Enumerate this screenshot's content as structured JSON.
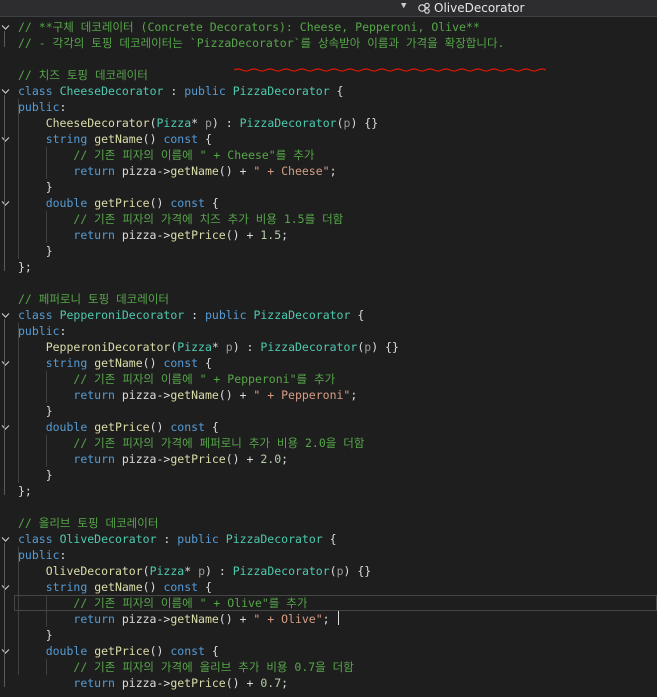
{
  "navigation": {
    "member_dropdown_label": "OliveDecorator"
  },
  "colors": {
    "background": "#1e1e1e",
    "comment": "#57a64a",
    "keyword": "#569cd6",
    "type": "#4ec9b0",
    "function": "#dcdcaa",
    "string": "#d69d85",
    "number": "#b5cea8",
    "spellcheck_squiggle": "#e51400"
  },
  "editor": {
    "lines": [
      [
        [
          "// **구체 데코레이터 (Concrete Decorators): Cheese, Pepperoni, Olive**",
          "cm"
        ]
      ],
      [
        [
          "// - 각각의 토핑 데코레이터는 `PizzaDecorator`를 상속받아 이름과 가격을 확장합니다.",
          "cm"
        ]
      ],
      [],
      [
        [
          "// 치즈 토핑 데코레이터",
          "cm"
        ]
      ],
      [
        [
          "class",
          "kw"
        ],
        [
          " ",
          "tx"
        ],
        [
          "CheeseDecorator",
          "ty"
        ],
        [
          " : ",
          "tx"
        ],
        [
          "public",
          "kw"
        ],
        [
          " ",
          "tx"
        ],
        [
          "PizzaDecorator",
          "ty"
        ],
        [
          " {",
          "tx"
        ]
      ],
      [
        [
          "public",
          "kw"
        ],
        [
          ":",
          "tx"
        ]
      ],
      [
        [
          "    ",
          "tx"
        ],
        [
          "CheeseDecorator",
          "fn"
        ],
        [
          "(",
          "tx"
        ],
        [
          "Pizza",
          "ty"
        ],
        [
          "* ",
          "tx"
        ],
        [
          "p",
          "pa"
        ],
        [
          ") : ",
          "tx"
        ],
        [
          "PizzaDecorator",
          "ty"
        ],
        [
          "(",
          "tx"
        ],
        [
          "p",
          "pa"
        ],
        [
          ") {}",
          "tx"
        ]
      ],
      [
        [
          "    ",
          "tx"
        ],
        [
          "string",
          "kw"
        ],
        [
          " ",
          "tx"
        ],
        [
          "getName",
          "fn"
        ],
        [
          "() ",
          "tx"
        ],
        [
          "const",
          "kw"
        ],
        [
          " {",
          "tx"
        ]
      ],
      [
        [
          "        ",
          "tx"
        ],
        [
          "// 기존 피자의 이름에 \" + Cheese\"를 추가",
          "cm"
        ]
      ],
      [
        [
          "        ",
          "tx"
        ],
        [
          "return",
          "kw"
        ],
        [
          " pizza->",
          "tx"
        ],
        [
          "getName",
          "fn"
        ],
        [
          "() + ",
          "tx"
        ],
        [
          "\" + Cheese\"",
          "st"
        ],
        [
          ";",
          "tx"
        ]
      ],
      [
        [
          "    }",
          "tx"
        ]
      ],
      [
        [
          "    ",
          "tx"
        ],
        [
          "double",
          "kw"
        ],
        [
          " ",
          "tx"
        ],
        [
          "getPrice",
          "fn"
        ],
        [
          "() ",
          "tx"
        ],
        [
          "const",
          "kw"
        ],
        [
          " {",
          "tx"
        ]
      ],
      [
        [
          "        ",
          "tx"
        ],
        [
          "// 기존 피자의 가격에 치즈 추가 비용 1.5를 더함",
          "cm"
        ]
      ],
      [
        [
          "        ",
          "tx"
        ],
        [
          "return",
          "kw"
        ],
        [
          " pizza->",
          "tx"
        ],
        [
          "getPrice",
          "fn"
        ],
        [
          "() + ",
          "tx"
        ],
        [
          "1.5",
          "nu"
        ],
        [
          ";",
          "tx"
        ]
      ],
      [
        [
          "    }",
          "tx"
        ]
      ],
      [
        [
          "};",
          "tx"
        ]
      ],
      [],
      [
        [
          "// 페퍼로니 토핑 데코레이터",
          "cm"
        ]
      ],
      [
        [
          "class",
          "kw"
        ],
        [
          " ",
          "tx"
        ],
        [
          "PepperoniDecorator",
          "ty"
        ],
        [
          " : ",
          "tx"
        ],
        [
          "public",
          "kw"
        ],
        [
          " ",
          "tx"
        ],
        [
          "PizzaDecorator",
          "ty"
        ],
        [
          " {",
          "tx"
        ]
      ],
      [
        [
          "public",
          "kw"
        ],
        [
          ":",
          "tx"
        ]
      ],
      [
        [
          "    ",
          "tx"
        ],
        [
          "PepperoniDecorator",
          "fn"
        ],
        [
          "(",
          "tx"
        ],
        [
          "Pizza",
          "ty"
        ],
        [
          "* ",
          "tx"
        ],
        [
          "p",
          "pa"
        ],
        [
          ") : ",
          "tx"
        ],
        [
          "PizzaDecorator",
          "ty"
        ],
        [
          "(",
          "tx"
        ],
        [
          "p",
          "pa"
        ],
        [
          ") {}",
          "tx"
        ]
      ],
      [
        [
          "    ",
          "tx"
        ],
        [
          "string",
          "kw"
        ],
        [
          " ",
          "tx"
        ],
        [
          "getName",
          "fn"
        ],
        [
          "() ",
          "tx"
        ],
        [
          "const",
          "kw"
        ],
        [
          " {",
          "tx"
        ]
      ],
      [
        [
          "        ",
          "tx"
        ],
        [
          "// 기존 피자의 이름에 \" + Pepperoni\"를 추가",
          "cm"
        ]
      ],
      [
        [
          "        ",
          "tx"
        ],
        [
          "return",
          "kw"
        ],
        [
          " pizza->",
          "tx"
        ],
        [
          "getName",
          "fn"
        ],
        [
          "() + ",
          "tx"
        ],
        [
          "\" + Pepperoni\"",
          "st"
        ],
        [
          ";",
          "tx"
        ]
      ],
      [
        [
          "    }",
          "tx"
        ]
      ],
      [
        [
          "    ",
          "tx"
        ],
        [
          "double",
          "kw"
        ],
        [
          " ",
          "tx"
        ],
        [
          "getPrice",
          "fn"
        ],
        [
          "() ",
          "tx"
        ],
        [
          "const",
          "kw"
        ],
        [
          " {",
          "tx"
        ]
      ],
      [
        [
          "        ",
          "tx"
        ],
        [
          "// 기존 피자의 가격에 페퍼로니 추가 비용 2.0을 더함",
          "cm"
        ]
      ],
      [
        [
          "        ",
          "tx"
        ],
        [
          "return",
          "kw"
        ],
        [
          " pizza->",
          "tx"
        ],
        [
          "getPrice",
          "fn"
        ],
        [
          "() + ",
          "tx"
        ],
        [
          "2.0",
          "nu"
        ],
        [
          ";",
          "tx"
        ]
      ],
      [
        [
          "    }",
          "tx"
        ]
      ],
      [
        [
          "};",
          "tx"
        ]
      ],
      [],
      [
        [
          "// 올리브 토핑 데코레이터",
          "cm"
        ]
      ],
      [
        [
          "class",
          "kw"
        ],
        [
          " ",
          "tx"
        ],
        [
          "OliveDecorator",
          "ty"
        ],
        [
          " : ",
          "tx"
        ],
        [
          "public",
          "kw"
        ],
        [
          " ",
          "tx"
        ],
        [
          "PizzaDecorator",
          "ty"
        ],
        [
          " {",
          "tx"
        ]
      ],
      [
        [
          "public",
          "kw"
        ],
        [
          ":",
          "tx"
        ]
      ],
      [
        [
          "    ",
          "tx"
        ],
        [
          "OliveDecorator",
          "fn"
        ],
        [
          "(",
          "tx"
        ],
        [
          "Pizza",
          "ty"
        ],
        [
          "* ",
          "tx"
        ],
        [
          "p",
          "pa"
        ],
        [
          ") : ",
          "tx"
        ],
        [
          "PizzaDecorator",
          "ty"
        ],
        [
          "(",
          "tx"
        ],
        [
          "p",
          "pa"
        ],
        [
          ") {}",
          "tx"
        ]
      ],
      [
        [
          "    ",
          "tx"
        ],
        [
          "string",
          "kw"
        ],
        [
          " ",
          "tx"
        ],
        [
          "getName",
          "fn"
        ],
        [
          "() ",
          "tx"
        ],
        [
          "const",
          "kw"
        ],
        [
          " {",
          "tx"
        ]
      ],
      [
        [
          "        ",
          "tx"
        ],
        [
          "// 기존 피자의 이름에 \" + Olive\"를 추가",
          "cm"
        ]
      ],
      [
        [
          "        ",
          "tx"
        ],
        [
          "return",
          "kw"
        ],
        [
          " pizza->",
          "tx"
        ],
        [
          "getName",
          "fn"
        ],
        [
          "() + ",
          "tx"
        ],
        [
          "\" + Olive\"",
          "st"
        ],
        [
          ";",
          "tx"
        ]
      ],
      [
        [
          "    }",
          "tx"
        ]
      ],
      [
        [
          "    ",
          "tx"
        ],
        [
          "double",
          "kw"
        ],
        [
          " ",
          "tx"
        ],
        [
          "getPrice",
          "fn"
        ],
        [
          "() ",
          "tx"
        ],
        [
          "const",
          "kw"
        ],
        [
          " {",
          "tx"
        ]
      ],
      [
        [
          "        ",
          "tx"
        ],
        [
          "// 기존 피자의 가격에 올리브 추가 비용 0.7을 더함",
          "cm"
        ]
      ],
      [
        [
          "        ",
          "tx"
        ],
        [
          "return",
          "kw"
        ],
        [
          " pizza->",
          "tx"
        ],
        [
          "getPrice",
          "fn"
        ],
        [
          "() + ",
          "tx"
        ],
        [
          "0.7",
          "nu"
        ],
        [
          ";",
          "tx"
        ]
      ]
    ]
  }
}
